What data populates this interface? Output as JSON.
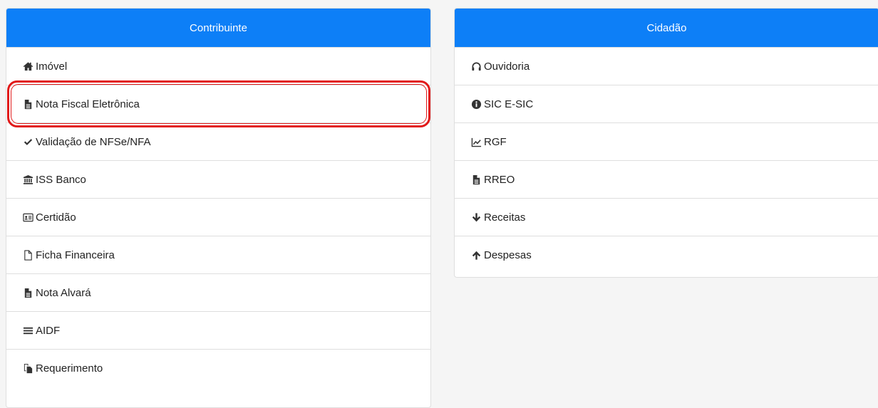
{
  "contribuinte": {
    "title": "Contribuinte",
    "items": [
      {
        "label": "Imóvel",
        "icon": "home-icon"
      },
      {
        "label": "Nota Fiscal Eletrônica",
        "icon": "file-text-icon"
      },
      {
        "label": "Validação de NFSe/NFA",
        "icon": "check-icon"
      },
      {
        "label": "ISS Banco",
        "icon": "bank-icon"
      },
      {
        "label": "Certidão",
        "icon": "id-card-icon"
      },
      {
        "label": "Ficha Financeira",
        "icon": "file-outline-icon"
      },
      {
        "label": "Nota Alvará",
        "icon": "file-text-icon"
      },
      {
        "label": "AIDF",
        "icon": "bars-icon"
      },
      {
        "label": "Requerimento",
        "icon": "copy-icon"
      }
    ]
  },
  "cidadao": {
    "title": "Cidadão",
    "items": [
      {
        "label": "Ouvidoria",
        "icon": "headphones-icon"
      },
      {
        "label": "SIC E-SIC",
        "icon": "info-circle-icon"
      },
      {
        "label": "RGF",
        "icon": "line-chart-icon"
      },
      {
        "label": "RREO",
        "icon": "file-text-icon"
      },
      {
        "label": "Receitas",
        "icon": "arrow-down-icon"
      },
      {
        "label": "Despesas",
        "icon": "arrow-up-icon"
      }
    ]
  },
  "colors": {
    "header": "#0d7ff7",
    "highlight": "#e11919"
  }
}
